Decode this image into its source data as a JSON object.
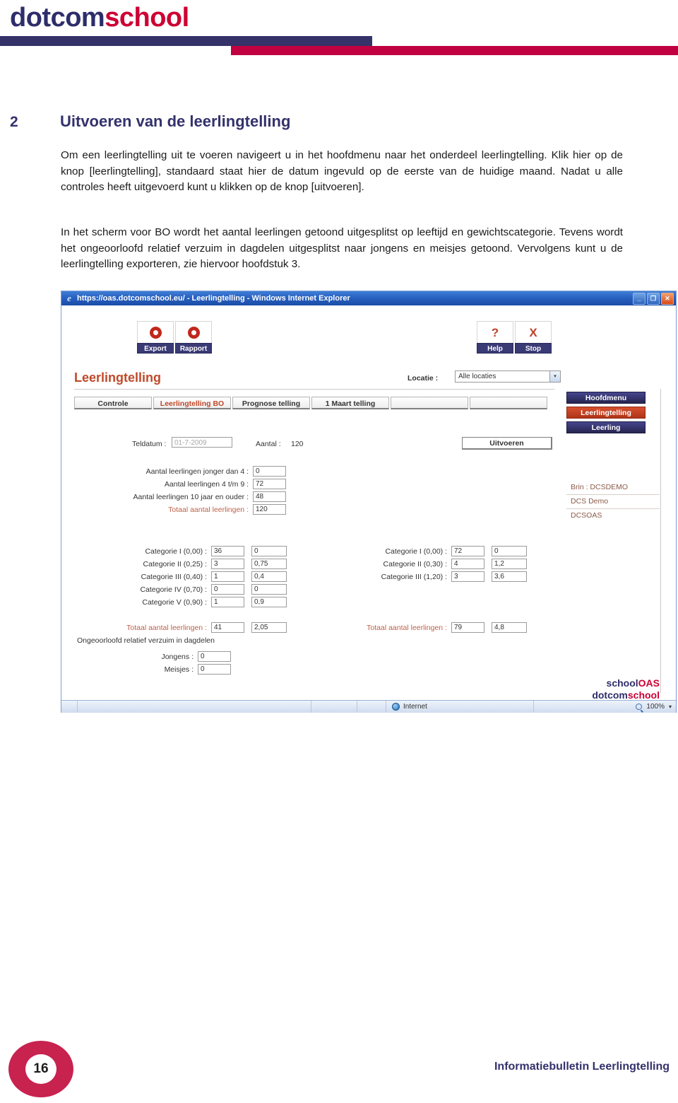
{
  "brand": {
    "logo_part1": "dotcom",
    "logo_part2": "school",
    "navy": "#2e2d6b",
    "red": "#cc0033"
  },
  "section": {
    "number": "2",
    "title": "Uitvoeren van de leerlingtelling",
    "paragraph_1": "Om een leerlingtelling uit te voeren navigeert u in het hoofdmenu naar het onderdeel leerlingtelling. Klik hier op de knop [leerlingtelling], standaard staat hier de datum ingevuld op de eerste van de huidige maand. Nadat u alle controles heeft uitgevoerd kunt u klikken op de knop [uitvoeren].",
    "paragraph_2": "In het scherm voor BO wordt het aantal leerlingen getoond uitgesplitst op leeftijd en gewichtscategorie. Tevens wordt het ongeoorloofd relatief verzuim in dagdelen uitgesplitst naar jongens en meisjes getoond. Vervolgens kunt u de leerlingtelling exporteren, zie hiervoor hoofdstuk 3."
  },
  "browser": {
    "title": "https://oas.dotcomschool.eu/ - Leerlingtelling - Windows Internet Explorer",
    "icon": "ie-logo-icon",
    "minimize_label": "_",
    "maximize_label": "❐",
    "close_label": "✕",
    "statusbar": {
      "zone_label": "Internet",
      "zone_icon": "globe-icon",
      "zoom_label": "100%",
      "zoom_icon": "zoom-icon",
      "zoom_caret": "▾"
    }
  },
  "app": {
    "title": "Leerlingtelling",
    "title_color": "#c0492a",
    "toolbar": [
      {
        "name": "export",
        "label": "Export",
        "icon": "ring-icon"
      },
      {
        "name": "rapport",
        "label": "Rapport",
        "icon": "ring-icon"
      },
      {
        "name": "help",
        "label": "Help",
        "icon": "question-mark-icon",
        "glyph": "?"
      },
      {
        "name": "stop",
        "label": "Stop",
        "icon": "x-mark-icon",
        "glyph": "X"
      }
    ],
    "locatie": {
      "label": "Locatie :",
      "value": "Alle locaties",
      "arrow": "▾"
    },
    "tabs": [
      {
        "label": "Controle",
        "active": false
      },
      {
        "label": "Leerlingtelling BO",
        "active": true
      },
      {
        "label": "Prognose telling",
        "active": false
      },
      {
        "label": "1 Maart telling",
        "active": false
      },
      {
        "label": "",
        "active": false
      },
      {
        "label": "",
        "active": false
      }
    ],
    "menu": [
      {
        "label": "Hoofdmenu",
        "active": false
      },
      {
        "label": "Leerlingtelling",
        "active": true
      },
      {
        "label": "Leerling",
        "active": false
      }
    ],
    "teldatum": {
      "label": "Teldatum :",
      "value": "01-7-2009"
    },
    "aantal": {
      "label": "Aantal :",
      "value": "120"
    },
    "uitvoeren_label": "Uitvoeren",
    "age_rows": [
      {
        "label": "Aantal leerlingen jonger dan 4 :",
        "value": "0",
        "total": false
      },
      {
        "label": "Aantal leerlingen 4 t/m 9 :",
        "value": "72",
        "total": false
      },
      {
        "label": "Aantal leerlingen 10 jaar en ouder :",
        "value": "48",
        "total": false
      },
      {
        "label": "Totaal aantal leerlingen :",
        "value": "120",
        "total": true
      }
    ],
    "categories_left": [
      {
        "label": "Categorie I (0,00) :",
        "count": "36",
        "weight": "0"
      },
      {
        "label": "Categorie II (0,25) :",
        "count": "3",
        "weight": "0,75"
      },
      {
        "label": "Categorie III (0,40) :",
        "count": "1",
        "weight": "0,4"
      },
      {
        "label": "Categorie IV (0,70) :",
        "count": "0",
        "weight": "0"
      },
      {
        "label": "Categorie V (0,90) :",
        "count": "1",
        "weight": "0,9"
      }
    ],
    "total_left": {
      "label": "Totaal aantal leerlingen :",
      "count": "41",
      "weight": "2,05"
    },
    "categories_right": [
      {
        "label": "Categorie I (0,00) :",
        "count": "72",
        "weight": "0"
      },
      {
        "label": "Categorie II (0,30) :",
        "count": "4",
        "weight": "1,2"
      },
      {
        "label": "Categorie III (1,20) :",
        "count": "3",
        "weight": "3,6"
      }
    ],
    "total_right": {
      "label": "Totaal aantal leerlingen :",
      "count": "79",
      "weight": "4,8"
    },
    "verzuim": {
      "title": "Ongeoorloofd relatief verzuim in dagdelen",
      "rows": [
        {
          "label": "Jongens :",
          "value": "0"
        },
        {
          "label": "Meisjes :",
          "value": "0"
        }
      ]
    },
    "brin_panel": [
      "Brin : DCSDEMO",
      "DCS Demo",
      "DCSOAS"
    ],
    "footer_logo": {
      "line1_a": "school",
      "line1_b": "OAS",
      "line2_a": "dotcom",
      "line2_b": "school"
    }
  },
  "page_footer": {
    "page_number": "16",
    "title": "Informatiebulletin Leerlingtelling"
  }
}
